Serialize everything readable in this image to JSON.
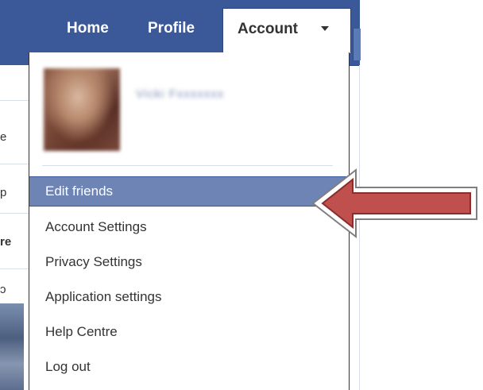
{
  "header": {
    "nav": {
      "home": "Home",
      "profile": "Profile",
      "account": "Account"
    }
  },
  "account_menu": {
    "user_name": "Vicki Fxxxxxxx",
    "items": [
      {
        "label": "Edit friends",
        "selected": true
      },
      {
        "label": "Account Settings",
        "selected": false
      },
      {
        "label": "Privacy Settings",
        "selected": false
      },
      {
        "label": "Application settings",
        "selected": false
      },
      {
        "label": "Help Centre",
        "selected": false
      },
      {
        "label": "Log out",
        "selected": false
      }
    ]
  },
  "page_sliver": {
    "chars": [
      "e",
      "p",
      "re",
      "ɔ"
    ]
  },
  "colors": {
    "header_blue": "#3b5998",
    "menu_highlight": "#6d84b4",
    "arrow_fill": "#c0504d",
    "arrow_outline": "#ffffff"
  },
  "icons": {
    "dropdown_caret": "caret-down-icon",
    "pointer": "arrow-left-icon"
  }
}
